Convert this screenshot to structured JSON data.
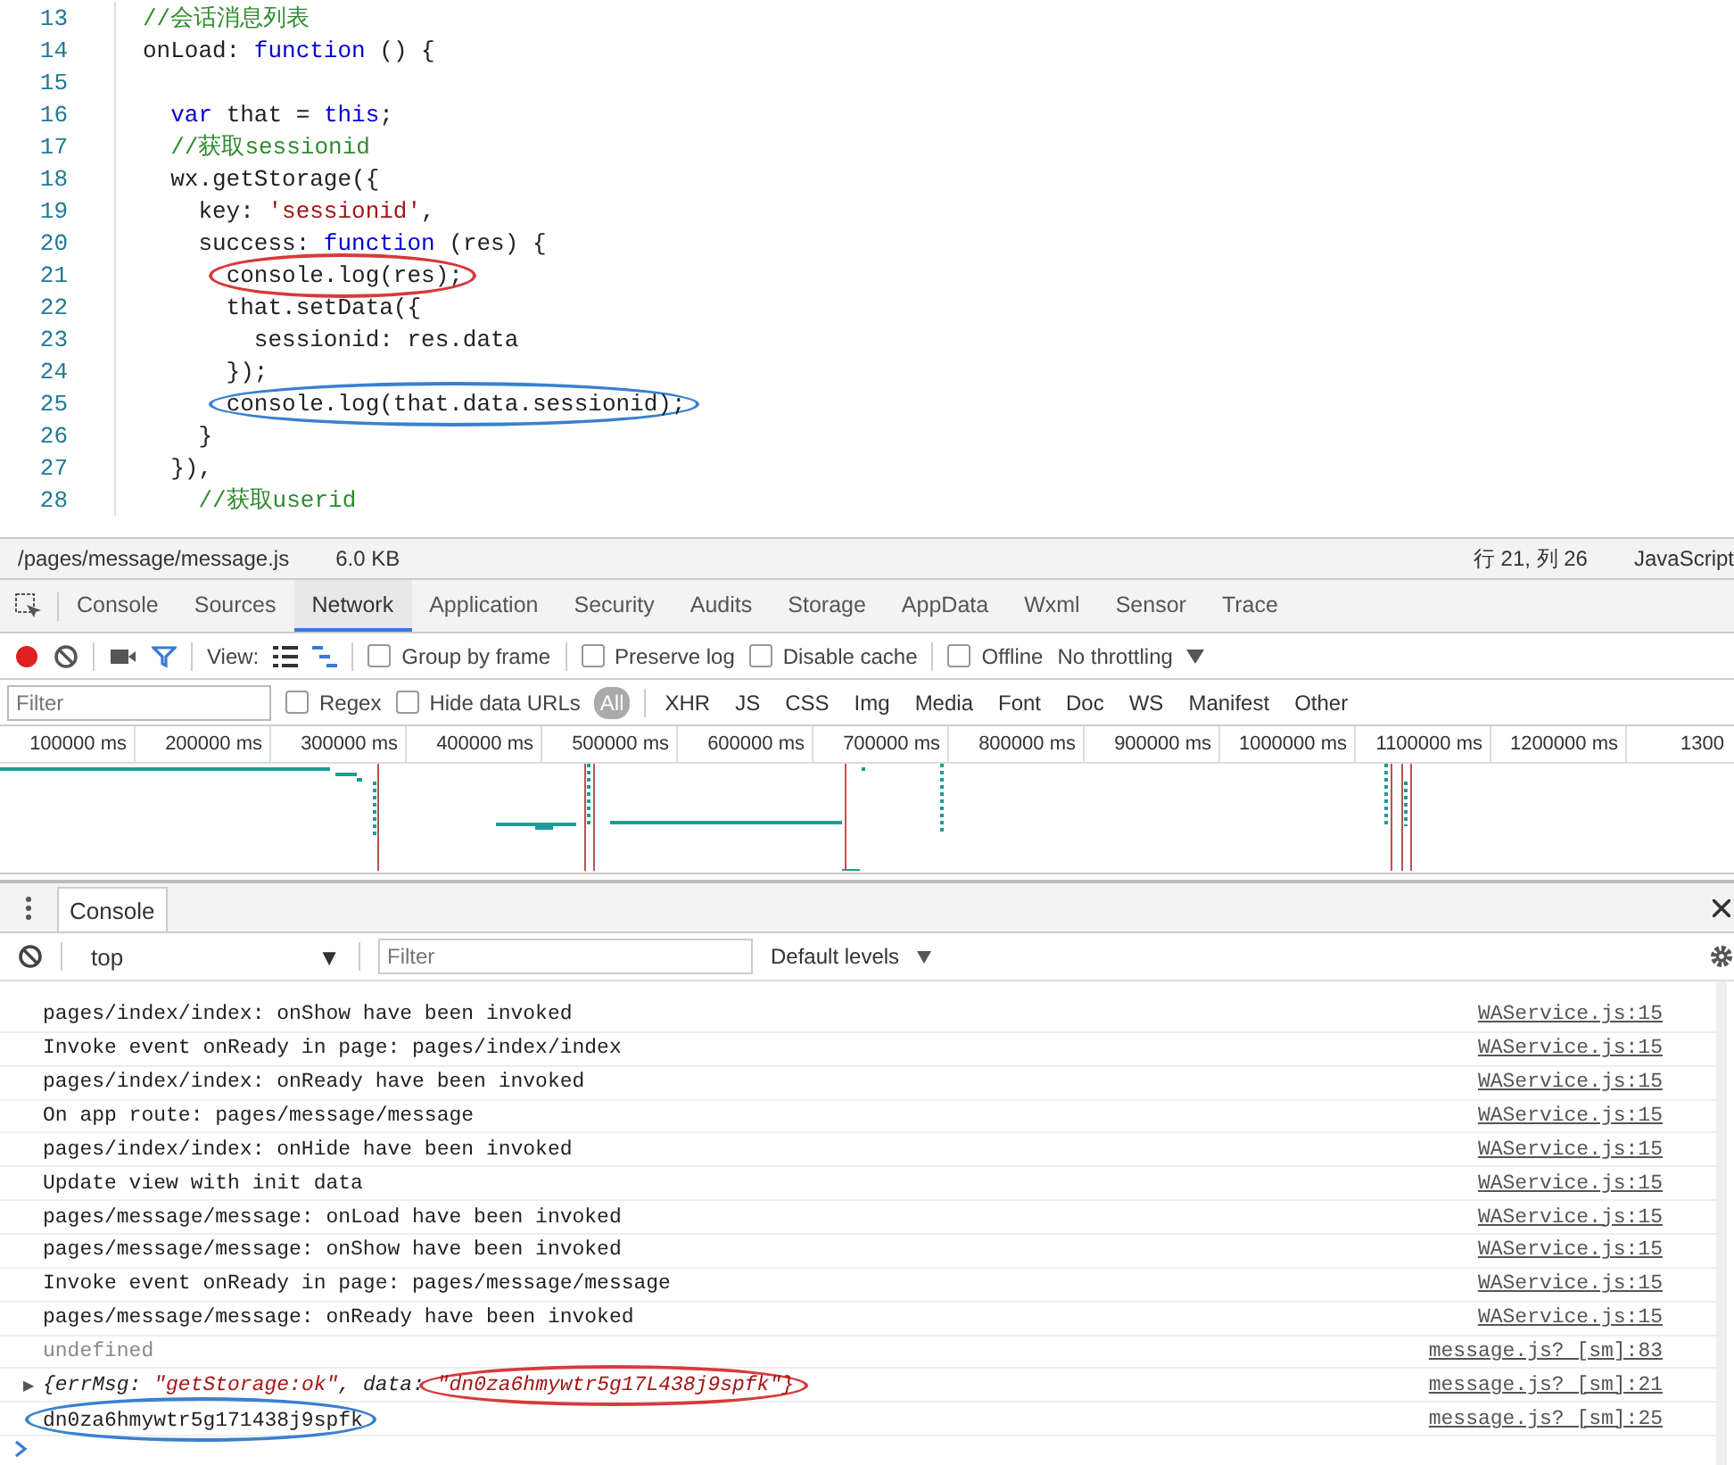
{
  "editor": {
    "lines": [
      {
        "number": "13",
        "tokens": [
          {
            "kind": "comment",
            "text": "//会话消息列表"
          }
        ]
      },
      {
        "number": "14",
        "tokens": [
          {
            "kind": "plain",
            "text": "onLoad: "
          },
          {
            "kind": "keyword",
            "text": "function"
          },
          {
            "kind": "plain",
            "text": " () {"
          }
        ]
      },
      {
        "number": "15"
      },
      {
        "number": "16",
        "tokens": [
          {
            "kind": "keyword",
            "text": "  var"
          },
          {
            "kind": "plain",
            "text": " that = "
          },
          {
            "kind": "keyword",
            "text": "this"
          },
          {
            "kind": "plain",
            "text": ";"
          }
        ]
      },
      {
        "number": "17",
        "tokens": [
          {
            "kind": "comment",
            "text": "  //获取sessionid"
          }
        ]
      },
      {
        "number": "18",
        "tokens": [
          {
            "kind": "plain",
            "text": "  wx.getStorage({"
          }
        ]
      },
      {
        "number": "19",
        "tokens": [
          {
            "kind": "plain",
            "text": "    key: "
          },
          {
            "kind": "string",
            "text": "'sessionid'"
          },
          {
            "kind": "plain",
            "text": ","
          }
        ]
      },
      {
        "number": "20",
        "tokens": [
          {
            "kind": "plain",
            "text": "    success: "
          },
          {
            "kind": "keyword",
            "text": "function"
          },
          {
            "kind": "plain",
            "text": " (res) {"
          }
        ]
      },
      {
        "number": "21",
        "tokens": [
          {
            "kind": "plain",
            "text": "      console.log(res);",
            "circle": {
              "color": "#d83a3a"
            }
          }
        ]
      },
      {
        "number": "22",
        "tokens": [
          {
            "kind": "plain",
            "text": "      that.setData({"
          }
        ]
      },
      {
        "number": "23",
        "tokens": [
          {
            "kind": "plain",
            "text": "        sessionid: res.data"
          }
        ]
      },
      {
        "number": "24",
        "tokens": [
          {
            "kind": "plain",
            "text": "      });"
          }
        ]
      },
      {
        "number": "25",
        "tokens": [
          {
            "kind": "plain",
            "text": "      console.log(that.data.sessionid);",
            "circle": {
              "color": "#3a80d0"
            }
          }
        ]
      },
      {
        "number": "26",
        "tokens": [
          {
            "kind": "plain",
            "text": "    }"
          }
        ]
      },
      {
        "number": "27",
        "tokens": [
          {
            "kind": "plain",
            "text": "  }),"
          }
        ]
      },
      {
        "number": "28",
        "tokens": [
          {
            "kind": "comment",
            "text": "    //获取userid"
          }
        ]
      }
    ]
  },
  "file_status": {
    "path": "/pages/message/message.js",
    "size": "6.0 KB",
    "position": "行 21, 列 26",
    "language": "JavaScript"
  },
  "devtools_tabs": [
    {
      "label": "Console",
      "selected": false
    },
    {
      "label": "Sources",
      "selected": false
    },
    {
      "label": "Network",
      "selected": true
    },
    {
      "label": "Application",
      "selected": false
    },
    {
      "label": "Security",
      "selected": false
    },
    {
      "label": "Audits",
      "selected": false
    },
    {
      "label": "Storage",
      "selected": false
    },
    {
      "label": "AppData",
      "selected": false
    },
    {
      "label": "Wxml",
      "selected": false
    },
    {
      "label": "Sensor",
      "selected": false
    },
    {
      "label": "Trace",
      "selected": false
    }
  ],
  "network_toolbar": {
    "recording": true,
    "view_label": "View:",
    "options": [
      {
        "label": "Group by frame",
        "checked": false
      },
      {
        "label": "Preserve log",
        "checked": false
      },
      {
        "label": "Disable cache",
        "checked": false
      },
      {
        "label": "Offline",
        "checked": false
      }
    ],
    "throttling": "No throttling"
  },
  "filter_bar": {
    "placeholder": "Filter",
    "options": [
      {
        "label": "Regex",
        "checked": false
      },
      {
        "label": "Hide data URLs",
        "checked": false
      }
    ],
    "types": [
      {
        "label": "All",
        "selected": true
      },
      {
        "label": "XHR",
        "selected": false
      },
      {
        "label": "JS",
        "selected": false
      },
      {
        "label": "CSS",
        "selected": false
      },
      {
        "label": "Img",
        "selected": false
      },
      {
        "label": "Media",
        "selected": false
      },
      {
        "label": "Font",
        "selected": false
      },
      {
        "label": "Doc",
        "selected": false
      },
      {
        "label": "WS",
        "selected": false
      },
      {
        "label": "Manifest",
        "selected": false
      },
      {
        "label": "Other",
        "selected": false
      }
    ]
  },
  "timeline": {
    "ticks": [
      "100000 ms",
      "200000 ms",
      "300000 ms",
      "400000 ms",
      "500000 ms",
      "600000 ms",
      "700000 ms",
      "800000 ms",
      "900000 ms",
      "1000000 ms",
      "1100000 ms",
      "1200000 ms",
      "1300"
    ]
  },
  "drawer": {
    "tabs": [
      {
        "label": "Console",
        "selected": true
      }
    ]
  },
  "console_toolbar": {
    "context": "top",
    "context_arrow": "▼",
    "placeholder": "Filter",
    "levels": "Default levels"
  },
  "console": {
    "rows": [
      {
        "kind": "log",
        "text": "pages/index/index: onShow have been invoked",
        "source": "WAService.js:15"
      },
      {
        "kind": "log",
        "text": "Invoke event onReady in page: pages/index/index",
        "source": "WAService.js:15"
      },
      {
        "kind": "log",
        "text": "pages/index/index: onReady have been invoked",
        "source": "WAService.js:15"
      },
      {
        "kind": "log",
        "text": "On app route: pages/message/message",
        "source": "WAService.js:15"
      },
      {
        "kind": "log",
        "text": "pages/index/index: onHide have been invoked",
        "source": "WAService.js:15"
      },
      {
        "kind": "log",
        "text": "Update view with init data",
        "source": "WAService.js:15"
      },
      {
        "kind": "log",
        "text": "pages/message/message: onLoad have been invoked",
        "source": "WAService.js:15"
      },
      {
        "kind": "log",
        "text": "pages/message/message: onShow have been invoked",
        "source": "WAService.js:15"
      },
      {
        "kind": "log",
        "text": "Invoke event onReady in page: pages/message/message",
        "source": "WAService.js:15"
      },
      {
        "kind": "log",
        "text": "pages/message/message: onReady have been invoked",
        "source": "WAService.js:15"
      },
      {
        "kind": "undefined",
        "text": "undefined",
        "source": "message.js? [sm]:83"
      },
      {
        "kind": "object",
        "expander": "▶",
        "tokens": [
          {
            "kind": "plain",
            "text": "{errMsg: "
          },
          {
            "kind": "string",
            "text": "\"getStorage:ok\""
          },
          {
            "kind": "plain",
            "text": ", data: "
          },
          {
            "kind": "string",
            "text": "\"dn0za6hmywtr5g17L438j9spfk\"}",
            "circle": {
              "color": "#d83a3a"
            }
          }
        ],
        "source": "message.js? [sm]:21"
      },
      {
        "kind": "log",
        "text": "dn0za6hmywtr5g171438j9spfk",
        "circle": {
          "color": "#3a80d0"
        },
        "source": "message.js? [sm]:25"
      }
    ]
  }
}
